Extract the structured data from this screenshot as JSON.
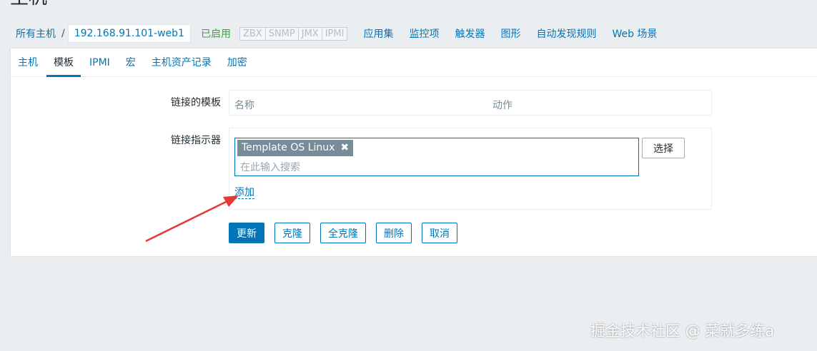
{
  "page": {
    "title": "主机"
  },
  "breadcrumb": {
    "all_hosts": "所有主机",
    "separator": "/",
    "current_host": "192.168.91.101-web1"
  },
  "host_status": {
    "enabled": "已启用",
    "availability": [
      "ZBX",
      "SNMP",
      "JMX",
      "IPMI"
    ]
  },
  "host_nav": [
    "应用集",
    "监控项",
    "触发器",
    "图形",
    "自动发现规则",
    "Web 场景"
  ],
  "tabs": [
    "主机",
    "模板",
    "IPMI",
    "宏",
    "主机资产记录",
    "加密"
  ],
  "active_tab": "模板",
  "form": {
    "linked_templates_label": "链接的模板",
    "columns": {
      "name": "名称",
      "action": "动作"
    },
    "link_new_label": "链接指示器",
    "selected_templates": [
      {
        "name": "Template OS Linux"
      }
    ],
    "search_placeholder": "在此输入搜索",
    "select_button": "选择",
    "add_link": "添加"
  },
  "buttons": {
    "update": "更新",
    "clone": "克隆",
    "full_clone": "全克隆",
    "delete": "删除",
    "cancel": "取消"
  },
  "watermark": "掘金技术社区 @ 菜就多练a",
  "colors": {
    "accent": "#0275b8",
    "enabled": "#429e47",
    "arrow": "#e53935",
    "background": "#ebeef0"
  }
}
